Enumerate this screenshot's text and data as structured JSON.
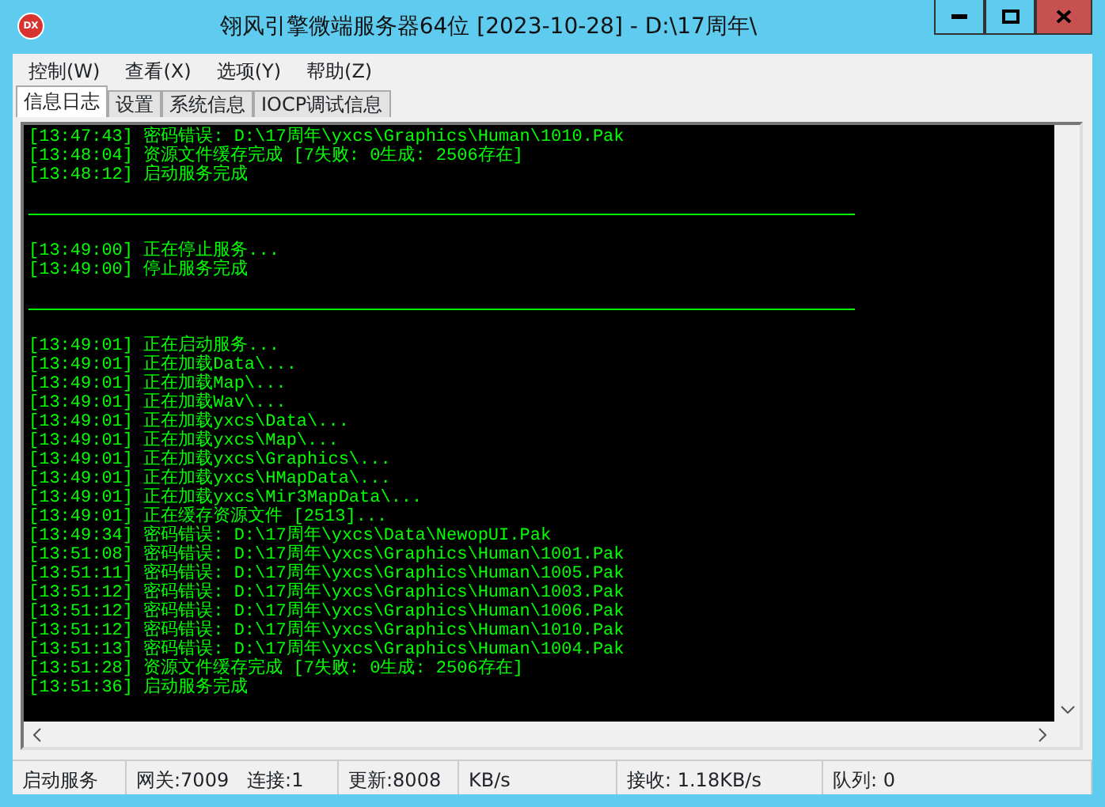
{
  "window": {
    "title": "翎风引擎微端服务器64位 [2023-10-28] - D:\\17周年\\",
    "app_icon": "DX"
  },
  "menu": [
    "控制(W)",
    "查看(X)",
    "选项(Y)",
    "帮助(Z)"
  ],
  "tabs": [
    {
      "label": "信息日志",
      "selected": true
    },
    {
      "label": "设置",
      "selected": false
    },
    {
      "label": "系统信息",
      "selected": false
    },
    {
      "label": "IOCP调试信息",
      "selected": false
    }
  ],
  "log": [
    {
      "kind": "text",
      "time": "[13:47:43]",
      "message": "密码错误: D:\\17周年\\yxcs\\Graphics\\Human\\1010.Pak"
    },
    {
      "kind": "text",
      "time": "[13:48:04]",
      "message": "资源文件缓存完成 [7失败: 0生成: 2506存在]"
    },
    {
      "kind": "text",
      "time": "[13:48:12]",
      "message": "启动服务完成"
    },
    {
      "kind": "blank"
    },
    {
      "kind": "rule"
    },
    {
      "kind": "blank"
    },
    {
      "kind": "text",
      "time": "[13:49:00]",
      "message": "正在停止服务..."
    },
    {
      "kind": "text",
      "time": "[13:49:00]",
      "message": "停止服务完成"
    },
    {
      "kind": "blank"
    },
    {
      "kind": "rule"
    },
    {
      "kind": "blank"
    },
    {
      "kind": "text",
      "time": "[13:49:01]",
      "message": "正在启动服务..."
    },
    {
      "kind": "text",
      "time": "[13:49:01]",
      "message": "正在加载Data\\..."
    },
    {
      "kind": "text",
      "time": "[13:49:01]",
      "message": "正在加载Map\\..."
    },
    {
      "kind": "text",
      "time": "[13:49:01]",
      "message": "正在加载Wav\\..."
    },
    {
      "kind": "text",
      "time": "[13:49:01]",
      "message": "正在加载yxcs\\Data\\..."
    },
    {
      "kind": "text",
      "time": "[13:49:01]",
      "message": "正在加载yxcs\\Map\\..."
    },
    {
      "kind": "text",
      "time": "[13:49:01]",
      "message": "正在加载yxcs\\Graphics\\..."
    },
    {
      "kind": "text",
      "time": "[13:49:01]",
      "message": "正在加载yxcs\\HMapData\\..."
    },
    {
      "kind": "text",
      "time": "[13:49:01]",
      "message": "正在加载yxcs\\Mir3MapData\\..."
    },
    {
      "kind": "text",
      "time": "[13:49:01]",
      "message": "正在缓存资源文件 [2513]..."
    },
    {
      "kind": "text",
      "time": "[13:49:34]",
      "message": "密码错误: D:\\17周年\\yxcs\\Data\\NewopUI.Pak"
    },
    {
      "kind": "text",
      "time": "[13:51:08]",
      "message": "密码错误: D:\\17周年\\yxcs\\Graphics\\Human\\1001.Pak"
    },
    {
      "kind": "text",
      "time": "[13:51:11]",
      "message": "密码错误: D:\\17周年\\yxcs\\Graphics\\Human\\1005.Pak"
    },
    {
      "kind": "text",
      "time": "[13:51:12]",
      "message": "密码错误: D:\\17周年\\yxcs\\Graphics\\Human\\1003.Pak"
    },
    {
      "kind": "text",
      "time": "[13:51:12]",
      "message": "密码错误: D:\\17周年\\yxcs\\Graphics\\Human\\1006.Pak"
    },
    {
      "kind": "text",
      "time": "[13:51:12]",
      "message": "密码错误: D:\\17周年\\yxcs\\Graphics\\Human\\1010.Pak"
    },
    {
      "kind": "text",
      "time": "[13:51:13]",
      "message": "密码错误: D:\\17周年\\yxcs\\Graphics\\Human\\1004.Pak"
    },
    {
      "kind": "text",
      "time": "[13:51:28]",
      "message": "资源文件缓存完成 [7失败: 0生成: 2506存在]"
    },
    {
      "kind": "text",
      "time": "[13:51:36]",
      "message": "启动服务完成"
    }
  ],
  "status_bar": [
    "启动服务",
    "网关:7009   连接:1",
    "更新:8008",
    "KB/s",
    "接收: 1.18KB/s",
    "队列: 0"
  ]
}
